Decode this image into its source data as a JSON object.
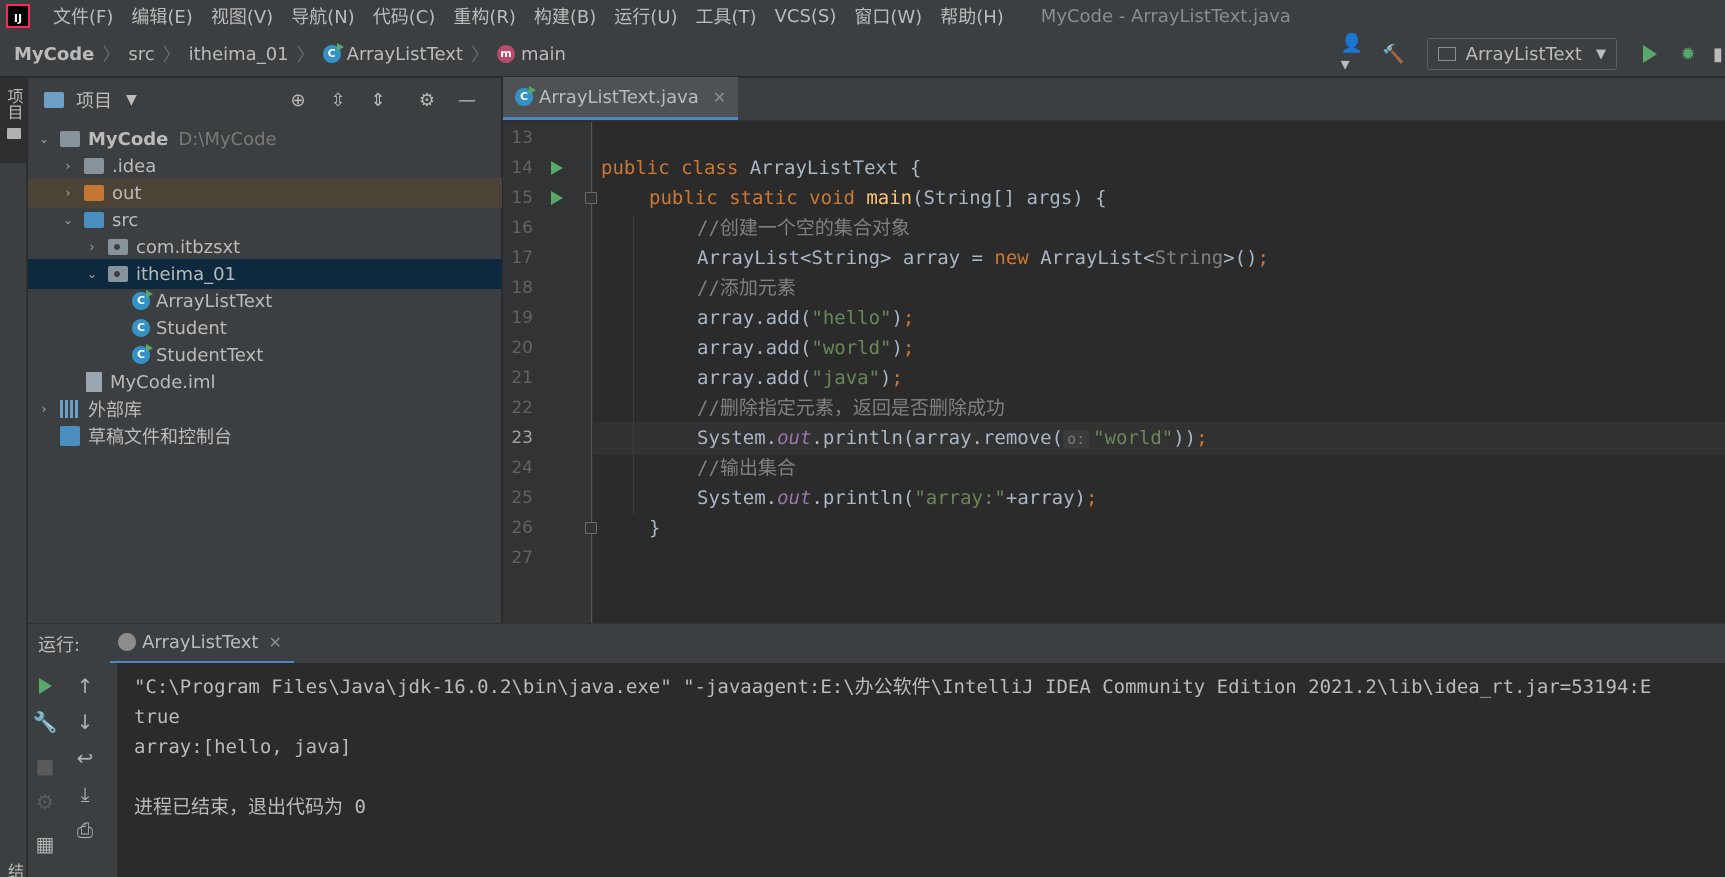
{
  "menubar": {
    "items": [
      "文件(F)",
      "编辑(E)",
      "视图(V)",
      "导航(N)",
      "代码(C)",
      "重构(R)",
      "构建(B)",
      "运行(U)",
      "工具(T)",
      "VCS(S)",
      "窗口(W)",
      "帮助(H)"
    ],
    "window_title": "MyCode - ArrayListText.java"
  },
  "navbar": {
    "crumbs": [
      "MyCode",
      "src",
      "itheima_01",
      "ArrayListText",
      "main"
    ],
    "run_config": "ArrayListText"
  },
  "left_strip": {
    "project_label": "项目",
    "structure_label": "结构"
  },
  "project": {
    "title": "项目",
    "tree": [
      {
        "label": "MyCode",
        "extra": "D:\\MyCode"
      },
      {
        "label": ".idea"
      },
      {
        "label": "out"
      },
      {
        "label": "src"
      },
      {
        "label": "com.itbzsxt"
      },
      {
        "label": "itheima_01"
      },
      {
        "label": "ArrayListText"
      },
      {
        "label": "Student"
      },
      {
        "label": "StudentText"
      },
      {
        "label": "MyCode.iml"
      },
      {
        "label": "外部库"
      },
      {
        "label": "草稿文件和控制台"
      }
    ]
  },
  "editor": {
    "tab": "ArrayListText.java",
    "line_numbers": [
      "13",
      "14",
      "15",
      "16",
      "17",
      "18",
      "19",
      "20",
      "21",
      "22",
      "23",
      "24",
      "25",
      "26",
      "27"
    ],
    "current_line": "23",
    "inlay_hint": "o:",
    "code": {
      "l14_kw": "public class ",
      "l14_rest": "ArrayListText {",
      "l15_kw": "public static void ",
      "l15_fn": "main",
      "l15_rest": "(String[] args) {",
      "l16": "//创建一个空的集合对象",
      "l17_a": "ArrayList<String> array = ",
      "l17_kw": "new ",
      "l17_b": "ArrayList<",
      "l17_c": "String",
      "l17_d": ">()",
      "l18": "//添加元素",
      "l19_a": "array.add(",
      "l19_s": "\"hello\"",
      "l20_a": "array.add(",
      "l20_s": "\"world\"",
      "l21_a": "array.add(",
      "l21_s": "\"java\"",
      "l22": "//删除指定元素，返回是否删除成功",
      "l23_a": "System.",
      "l23_f": "out",
      "l23_b": ".println(array.remove(",
      "l23_s": "\"world\"",
      "l23_c": "))",
      "l24": "//输出集合",
      "l25_a": "System.",
      "l25_f": "out",
      "l25_b": ".println(",
      "l25_s": "\"array:\"",
      "l25_c": "+array)",
      "semi": ";",
      "close_brace": "}"
    }
  },
  "run": {
    "label": "运行:",
    "tab": "ArrayListText",
    "console": [
      "\"C:\\Program Files\\Java\\jdk-16.0.2\\bin\\java.exe\" \"-javaagent:E:\\办公软件\\IntelliJ IDEA Community Edition 2021.2\\lib\\idea_rt.jar=53194:E",
      "true",
      "array:[hello, java]",
      "",
      "进程已结束，退出代码为 0"
    ]
  },
  "colors": {
    "background": "#2b2b2b",
    "panel": "#3c3f41",
    "selection": "#0d293e",
    "keyword": "#cc7832",
    "string": "#6a8759",
    "comment": "#808080",
    "accent": "#4a88c7",
    "run_green": "#59a869"
  }
}
